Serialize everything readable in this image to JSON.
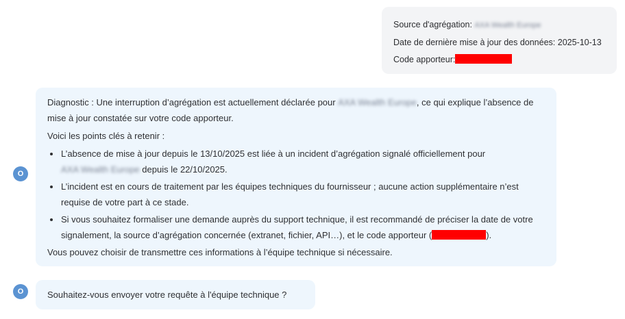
{
  "user_message": {
    "source_label": "Source d'agrégation:",
    "source_value": "AXA Wealth Europe",
    "update_label": "Date de dernière mise à jour des données:",
    "update_value": "2025-10-13",
    "code_label": "Code apporteur:"
  },
  "assistant": {
    "avatar_letter": "O",
    "diagnostic_before": "Diagnostic : Une interruption d’agrégation est actuellement déclarée pour",
    "diagnostic_source": "AXA Wealth Europe",
    "diagnostic_after": ", ce qui explique l’absence de mise à jour constatée sur votre code apporteur.",
    "points_intro": "Voici les points clés à retenir :",
    "points": {
      "p1_before": "L’absence de mise à jour depuis le 13/10/2025 est liée à un incident d’agrégation signalé officiellement pour",
      "p1_source": "AXA Wealth Europe",
      "p1_after": "depuis le 22/10/2025.",
      "p2": "L’incident est en cours de traitement par les équipes techniques du fournisseur ; aucune action supplémentaire n’est requise de votre part à ce stade.",
      "p3_before": "Si vous souhaitez formaliser une demande auprès du support technique, il est recommandé de préciser la date de votre signalement, la source d’agrégation concernée (extranet, fichier, API…), et le code apporteur (",
      "p3_after": ")."
    },
    "closing": "Vous pouvez choisir de transmettre ces informations à l’équipe technique si nécessaire.",
    "question": "Souhaitez-vous envoyer votre requête à l'équipe technique ?"
  },
  "colors": {
    "user_bubble_bg": "#f3f4f6",
    "assistant_bubble_bg": "#eef6fd",
    "avatar_bg": "#5b93d2",
    "redaction": "#ff0000"
  }
}
